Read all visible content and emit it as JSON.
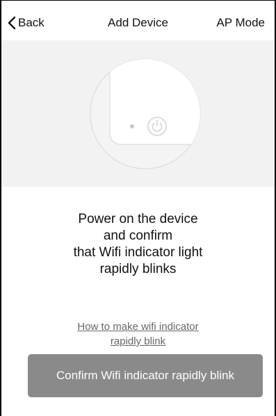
{
  "nav": {
    "back_label": "Back",
    "title": "Add Device",
    "right_action": "AP Mode"
  },
  "illustration": {
    "device_icon": "power-icon",
    "indicator_icon": "wifi-indicator-dot"
  },
  "instruction": {
    "lines": [
      "Power on the device",
      "and confirm",
      "that Wifi indicator light",
      "rapidly blinks"
    ]
  },
  "help_link": {
    "lines": [
      "How to make wifi indicator",
      "rapidly blink"
    ]
  },
  "confirm_button": {
    "label": "Confirm Wifi indicator rapidly blink",
    "enabled": false
  },
  "colors": {
    "illustration_bg": "#f2f2f2",
    "button_bg": "#8a8a8a",
    "link_color": "#666666"
  }
}
